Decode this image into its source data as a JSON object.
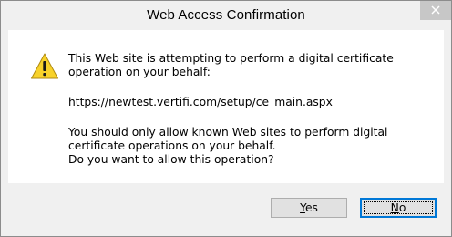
{
  "window": {
    "title": "Web Access Confirmation"
  },
  "titlebar": {
    "close_icon": "close-x-icon"
  },
  "message": {
    "icon": "warning-triangle-icon",
    "line1": "This Web site is attempting to perform a digital certificate operation on your behalf:",
    "url": "https://newtest.vertifi.com/setup/ce_main.aspx",
    "warning": "You should only allow known Web sites to perform digital certificate operations on your behalf.",
    "question": "Do you want to allow this operation?"
  },
  "buttons": {
    "yes": {
      "mnemonic": "Y",
      "rest": "es"
    },
    "no": {
      "mnemonic": "N",
      "rest": "o"
    }
  },
  "colors": {
    "accent": "#0078d7",
    "warning_fill": "#f8d22a",
    "close_hover": "#c7c7c7"
  }
}
